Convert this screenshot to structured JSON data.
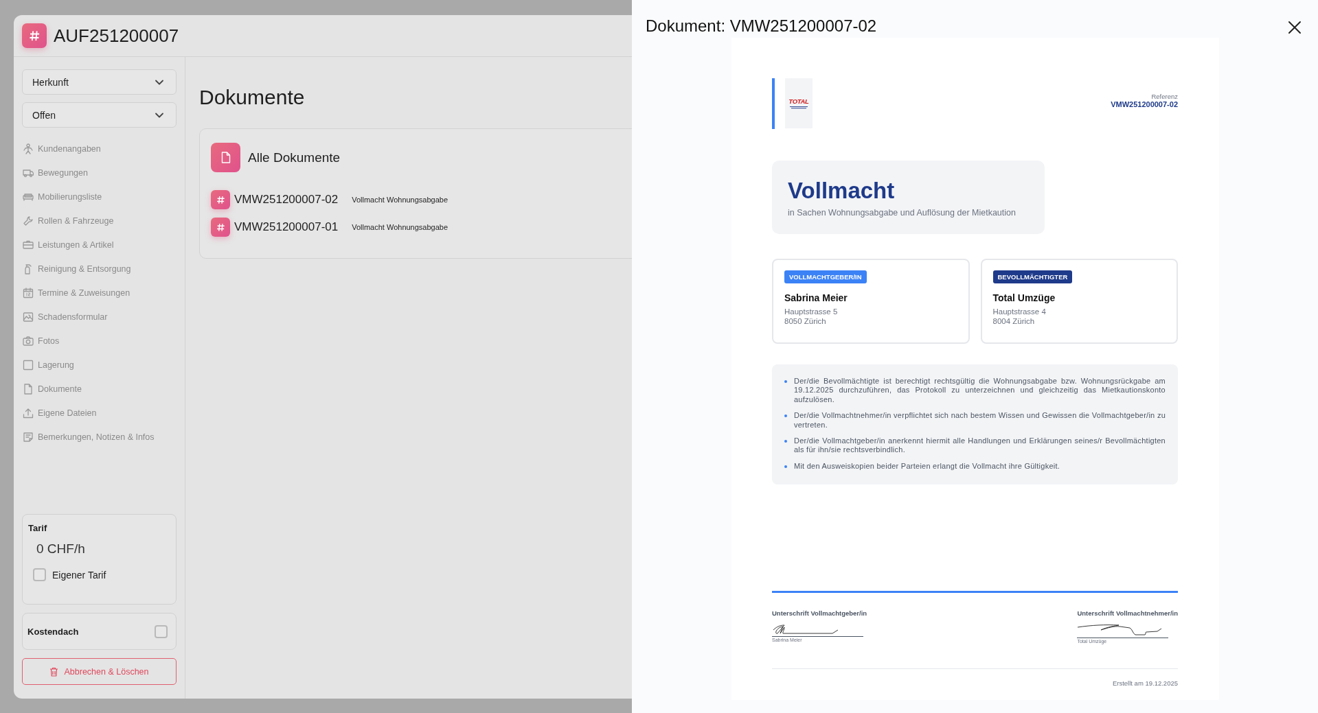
{
  "app": {
    "title": "AUF251200007"
  },
  "sidebar": {
    "selects": [
      {
        "value": "Herkunft"
      },
      {
        "value": "Offen"
      }
    ],
    "items": [
      {
        "label": "Kundenangaben"
      },
      {
        "label": "Bewegungen"
      },
      {
        "label": "Mobilierungsliste"
      },
      {
        "label": "Rollen & Fahrzeuge"
      },
      {
        "label": "Leistungen & Artikel"
      },
      {
        "label": "Reinigung & Entsorgung"
      },
      {
        "label": "Termine & Zuweisungen"
      },
      {
        "label": "Schadensformular"
      },
      {
        "label": "Fotos"
      },
      {
        "label": "Lagerung"
      },
      {
        "label": "Dokumente"
      },
      {
        "label": "Eigene Dateien"
      },
      {
        "label": "Bemerkungen, Notizen & Infos"
      }
    ],
    "tarif": {
      "title": "Tarif",
      "rate": "0 CHF/h",
      "custom": {
        "label": "Eigener Tarif",
        "checked": false
      }
    },
    "cost_cap": {
      "label": "Kostendach",
      "checked": false
    },
    "delete_button": "Abbrechen & Löschen"
  },
  "main": {
    "heading": "Dokumente",
    "group": {
      "title": "Alle Dokumente",
      "documents": [
        {
          "number": "VMW251200007-02",
          "type": "Vollmacht Wohnungsabgabe"
        },
        {
          "number": "VMW251200007-01",
          "type": "Vollmacht Wohnungsabgabe"
        }
      ]
    }
  },
  "drawer": {
    "title": "Dokument: VMW251200007-02",
    "document": {
      "logo_text": "TOTAL",
      "reference_label": "Referenz",
      "reference": "VMW251200007-02",
      "title": "Vollmacht",
      "subtitle": "in Sachen Wohnungsabgabe und Auflösung der Mietkaution",
      "parties": [
        {
          "role": "VOLLMACHTGEBER/IN",
          "color": "#3b82f6",
          "name": "Sabrina Meier",
          "street": "Hauptstrasse 5",
          "city": "8050 Zürich"
        },
        {
          "role": "BEVOLLMÄCHTIGTER",
          "color": "#1e3a8a",
          "name": "Total Umzüge",
          "street": "Hauptstrasse 4",
          "city": "8004 Zürich"
        }
      ],
      "clauses": [
        "Der/die Bevollmächtigte ist berechtigt rechtsgültig die Wohnungsabgabe bzw. Wohnungsrückgabe am 19.12.2025 durchzuführen, das Protokoll zu unterzeichnen und gleichzeitig das Mietkautionskonto aufzulösen.",
        "Der/die Vollmachtnehmer/in verpflichtet sich nach bestem Wissen und Gewissen die Vollmachtgeber/in zu vertreten.",
        "Der/die Vollmachtgeber/in anerkennt hiermit alle Handlungen und Erklärungen seines/r Bevollmächtigten als für ihn/sie rechtsverbindlich.",
        "Mit den Ausweiskopien beider Parteien erlangt die Vollmacht ihre Gültigkeit."
      ],
      "signatures": [
        {
          "label": "Unterschrift Vollmachtgeber/in",
          "signer": "Sabrina Meier"
        },
        {
          "label": "Unterschrift Vollmachtnehmer/in",
          "signer": "Total Umzüge"
        }
      ],
      "footer": "Erstellt am 19.12.2025"
    }
  }
}
